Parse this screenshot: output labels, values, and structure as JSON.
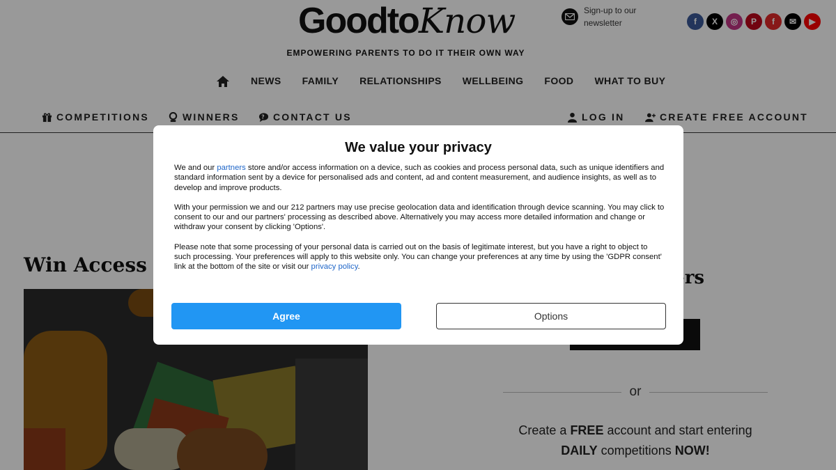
{
  "header": {
    "logo_part1": "Goodto",
    "logo_part2": "Know",
    "newsletter_text": "Sign-up to our newsletter",
    "tagline": "EMPOWERING PARENTS TO DO IT THEIR OWN WAY",
    "social_icons": [
      {
        "name": "facebook-icon",
        "color": "#3b5998",
        "glyph": "f"
      },
      {
        "name": "x-icon",
        "color": "#000000",
        "glyph": "X"
      },
      {
        "name": "instagram-icon",
        "color": "#c13584",
        "glyph": "◎"
      },
      {
        "name": "pinterest-icon",
        "color": "#bd081c",
        "glyph": "P"
      },
      {
        "name": "flipboard-icon",
        "color": "#e12828",
        "glyph": "f"
      },
      {
        "name": "email-icon",
        "color": "#000000",
        "glyph": "✉"
      },
      {
        "name": "youtube-icon",
        "color": "#ff0000",
        "glyph": "▶"
      }
    ]
  },
  "nav": {
    "items": [
      "NEWS",
      "FAMILY",
      "RELATIONSHIPS",
      "WELLBEING",
      "FOOD",
      "WHAT TO BUY"
    ]
  },
  "subnav": {
    "competitions": "COMPETITIONS",
    "winners": "WINNERS",
    "contact": "CONTACT US",
    "login": "LOG IN",
    "create_account": "CREATE FREE ACCOUNT"
  },
  "page": {
    "article_title": "Win Access t",
    "side_title": "bers",
    "or": "or",
    "promo_1": "Create a ",
    "promo_free": "FREE",
    "promo_2": " account and start entering",
    "promo_daily": "DAILY",
    "promo_3": " competitions ",
    "promo_now": "NOW!"
  },
  "modal": {
    "title": "We value your privacy",
    "p1_a": "We and our ",
    "p1_link": "partners",
    "p1_b": " store and/or access information on a device, such as cookies and process personal data, such as unique identifiers and standard information sent by a device for personalised ads and content, ad and content measurement, and audience insights, as well as to develop and improve products.",
    "p2": "With your permission we and our 212 partners may use precise geolocation data and identification through device scanning. You may click to consent to our and our partners' processing as described above. Alternatively you may access more detailed information and change or withdraw your consent by clicking 'Options'.",
    "p3_a": "Please note that some processing of your personal data is carried out on the basis of legitimate interest, but you have a right to object to such processing. Your preferences will apply to this website only. You can change your preferences at any time by using the 'GDPR consent' link at the bottom of the site or visit our ",
    "p3_link": "privacy policy",
    "p3_b": ".",
    "agree": "Agree",
    "options": "Options"
  },
  "colors": {
    "accent": "#2196f3",
    "link": "#1f66c8",
    "overlay": "rgba(0,0,0,0.40)"
  }
}
